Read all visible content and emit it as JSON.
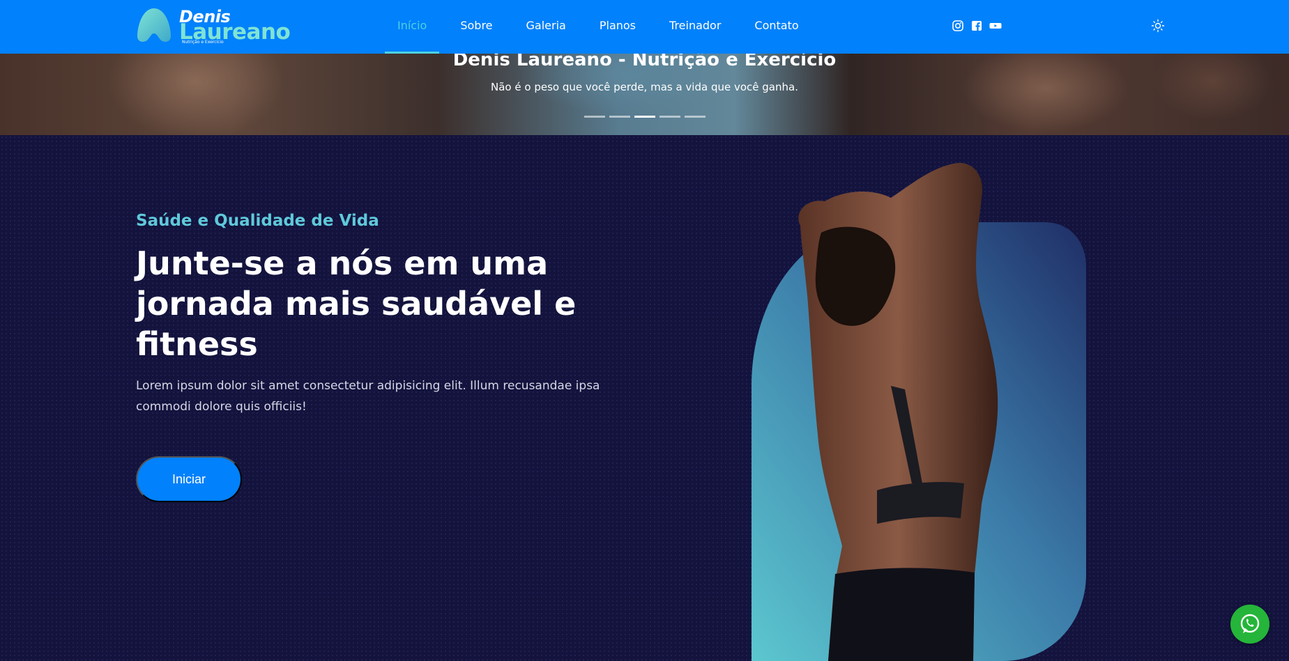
{
  "brand": {
    "line1": "Denis",
    "line2": "Laureano",
    "tagline": "Nutrição e Exercício",
    "accent": "#7fe3d4"
  },
  "nav": {
    "items": [
      {
        "label": "Início",
        "active": true
      },
      {
        "label": "Sobre",
        "active": false
      },
      {
        "label": "Galeria",
        "active": false
      },
      {
        "label": "Planos",
        "active": false
      },
      {
        "label": "Treinador",
        "active": false
      },
      {
        "label": "Contato",
        "active": false
      }
    ],
    "social": [
      "instagram-icon",
      "facebook-icon",
      "youtube-icon"
    ],
    "theme_toggle_icon": "sun-icon"
  },
  "carousel": {
    "title": "Denis Laureano - Nutrição e Exercício",
    "subtitle": "Não é o peso que você perde, mas a vida que você ganha.",
    "slides": 5,
    "active_slide": 3
  },
  "hero": {
    "eyebrow": "Saúde e Qualidade de Vida",
    "title": "Junte-se a nós em uma jornada mais saudável e fitness",
    "text": "Lorem ipsum dolor sit amet consectetur adipisicing elit. Illum recusandae ipsa commodi dolore quis officiis!",
    "button_label": "Iniciar"
  },
  "floating": {
    "whatsapp_icon": "whatsapp-icon"
  },
  "colors": {
    "primary": "#0181fb",
    "background": "#13133d",
    "accent": "#4dd1e0",
    "whatsapp": "#25b53a"
  }
}
